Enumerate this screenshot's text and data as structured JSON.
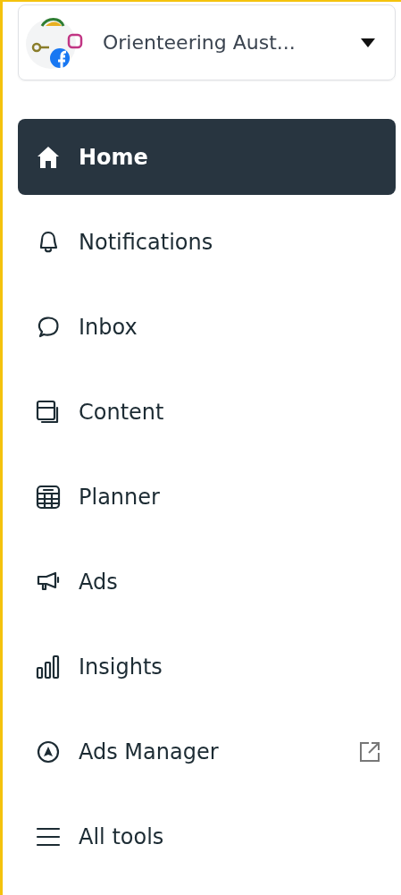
{
  "account": {
    "name": "Orienteering Aust..."
  },
  "nav": [
    {
      "label": "Home",
      "selected": true
    },
    {
      "label": "Notifications",
      "selected": false
    },
    {
      "label": "Inbox",
      "selected": false
    },
    {
      "label": "Content",
      "selected": false
    },
    {
      "label": "Planner",
      "selected": false
    },
    {
      "label": "Ads",
      "selected": false
    },
    {
      "label": "Insights",
      "selected": false
    },
    {
      "label": "Ads Manager",
      "selected": false,
      "external": true
    },
    {
      "label": "All tools",
      "selected": false
    }
  ]
}
